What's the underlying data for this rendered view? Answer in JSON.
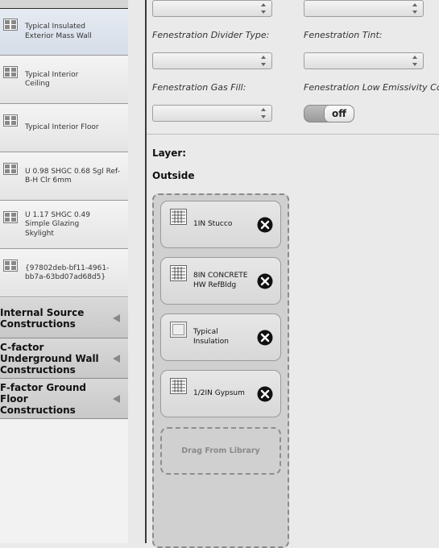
{
  "sidebar": {
    "library_items": [
      {
        "label": "Typical Insulated\nExterior Mass Wall",
        "icon": "construction-icon",
        "selected": true
      },
      {
        "label": "Typical Interior\nCeiling",
        "icon": "construction-icon",
        "selected": false
      },
      {
        "label": "Typical Interior Floor",
        "icon": "construction-icon",
        "selected": false
      },
      {
        "label": "U 0.98 SHGC 0.68 Sgl Ref-\nB-H Clr 6mm",
        "icon": "construction-icon",
        "selected": false
      },
      {
        "label": "U 1.17 SHGC 0.49\nSimple Glazing\nSkylight",
        "icon": "construction-icon",
        "selected": false
      },
      {
        "label": "{97802deb-bf11-4961-\nbb7a-63bd07ad68d5}",
        "icon": "construction-icon",
        "selected": false
      }
    ],
    "categories": [
      {
        "label": "Internal Source\nConstructions",
        "icon": "collapse-arrow-icon"
      },
      {
        "label": "C-factor\nUnderground Wall\nConstructions",
        "icon": "collapse-arrow-icon"
      },
      {
        "label": "F-factor Ground Floor\nConstructions",
        "icon": "collapse-arrow-icon"
      }
    ]
  },
  "fields": {
    "divider_type_label": "Fenestration Divider Type:",
    "tint_label": "Fenestration Tint:",
    "gas_fill_label": "Fenestration Gas Fill:",
    "low_e_label": "Fenestration Low Emissivity Co",
    "low_e_toggle": "off"
  },
  "layers": {
    "layer_label": "Layer:",
    "outside_label": "Outside",
    "items": [
      {
        "label": "1IN Stucco",
        "icon": "material-icon"
      },
      {
        "label": "8IN CONCRETE\nHW RefBldg",
        "icon": "material-icon"
      },
      {
        "label": "Typical\nInsulation",
        "icon": "insulation-material-icon"
      },
      {
        "label": "1/2IN Gypsum",
        "icon": "material-icon"
      }
    ],
    "drop_zone": "Drag From Library"
  },
  "colors": {
    "panel_bg": "#eaeaea",
    "selected_item_bg": "#dde3ec",
    "category_bg": "#cfcfcf",
    "layers_bg": "#d0d0d0"
  }
}
